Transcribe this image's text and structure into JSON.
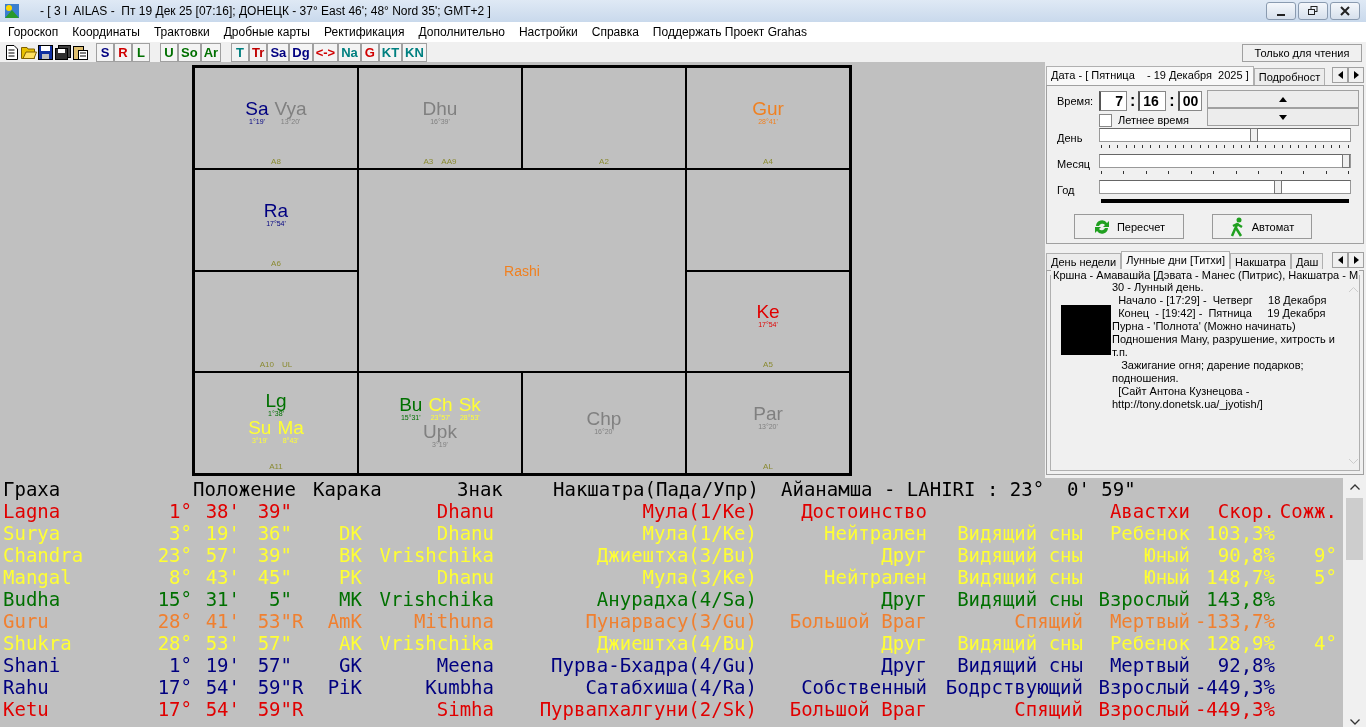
{
  "window": {
    "title": "- [ 3 I  AILAS -  Пт 19 Дек 25 [07:16]; ДОНЕЦК - 37° East 46'; 48° Nord 35'; GMT+2 ]"
  },
  "menu": [
    "Гороскоп",
    "Координаты",
    "Трактовки",
    "Дробные карты",
    "Ректификация",
    "Дополнительно",
    "Настройки",
    "Справка",
    "Поддержать Проект Grahas"
  ],
  "toolbar": {
    "groups": [
      [
        {
          "label": "S",
          "color": "#000080"
        },
        {
          "label": "R",
          "color": "#d00000"
        },
        {
          "label": "L",
          "color": "#007000"
        }
      ],
      [
        {
          "label": "U",
          "color": "#007000"
        },
        {
          "label": "So",
          "color": "#007000"
        },
        {
          "label": "Ar",
          "color": "#007000"
        }
      ],
      [
        {
          "label": "T",
          "color": "#008080"
        },
        {
          "label": "Tr",
          "color": "#c00000"
        },
        {
          "label": "Sa",
          "color": "#000080"
        },
        {
          "label": "Dg",
          "color": "#000080"
        },
        {
          "label": "<->",
          "color": "#d00000"
        },
        {
          "label": "Na",
          "color": "#008080"
        },
        {
          "label": "G",
          "color": "#d00000"
        },
        {
          "label": "KT",
          "color": "#008080"
        },
        {
          "label": "KN",
          "color": "#008080"
        }
      ]
    ],
    "read_only_button": "Только для чтения"
  },
  "chart": {
    "title": "Rashi",
    "cells": [
      {
        "lines": [
          {
            "planets": [
              {
                "abbr": "Sa",
                "deg": "1°19'",
                "color": "#000080"
              },
              {
                "abbr": "Vya",
                "deg": "13°20'",
                "color": "#808080"
              }
            ]
          }
        ],
        "labels": [
          "A8"
        ]
      },
      {
        "lines": [
          {
            "planets": [
              {
                "abbr": "Dhu",
                "deg": "16°39'",
                "color": "#808080"
              }
            ]
          }
        ],
        "labels": [
          "A3",
          "AA9"
        ]
      },
      {
        "labels": [
          "A2"
        ]
      },
      {
        "lines": [
          {
            "planets": [
              {
                "abbr": "Gur",
                "deg": "28°41'",
                "color": "#f08020"
              }
            ]
          }
        ],
        "labels": [
          "A4"
        ]
      },
      {
        "lines": [
          {
            "planets": [
              {
                "abbr": "Ra",
                "deg": "17°54'",
                "color": "#000080"
              }
            ]
          }
        ],
        "labels": [
          "A6"
        ]
      },
      {},
      {
        "labels": [
          "A10",
          "UL"
        ]
      },
      {
        "lines": [
          {
            "planets": [
              {
                "abbr": "Ke",
                "deg": "17°54'",
                "color": "#e00000"
              }
            ]
          }
        ],
        "labels": [
          "A5"
        ]
      },
      {
        "lines": [
          {
            "planets": [
              {
                "abbr": "Lg",
                "deg": "1°38'",
                "color": "#007000"
              }
            ]
          },
          {
            "planets": [
              {
                "abbr": "Su",
                "deg": "3°19'",
                "color": "#ffff33"
              },
              {
                "abbr": "Ma",
                "deg": "8°43'",
                "color": "#ffff33"
              }
            ]
          }
        ],
        "labels": [
          "A11"
        ]
      },
      {
        "lines": [
          {
            "planets": [
              {
                "abbr": "Bu",
                "deg": "15°31'",
                "color": "#007000"
              },
              {
                "abbr": "Ch",
                "deg": "23°57'",
                "color": "#ffff33"
              },
              {
                "abbr": "Sk",
                "deg": "28°53'",
                "color": "#ffff33"
              }
            ]
          },
          {
            "planets": [
              {
                "abbr": "Upk",
                "deg": "3°19'",
                "color": "#808080"
              }
            ]
          }
        ]
      },
      {
        "lines": [
          {
            "planets": [
              {
                "abbr": "Chp",
                "deg": "16°20'",
                "color": "#808080"
              }
            ]
          }
        ]
      },
      {
        "lines": [
          {
            "planets": [
              {
                "abbr": "Par",
                "deg": "13°20'",
                "color": "#808080"
              }
            ]
          }
        ],
        "labels": [
          "AL"
        ]
      }
    ]
  },
  "date_panel": {
    "tabs": [
      {
        "label": "Дата - [ Пятница    - 19 Декабря  2025 ]",
        "selected": true
      },
      {
        "label": "Подробност",
        "selected": false
      }
    ],
    "time_label": "Время:",
    "hour": "7",
    "minute": "16",
    "second": "00",
    "separators": [
      ":",
      ":"
    ],
    "dst": {
      "label": "Летнее время",
      "checked": false
    },
    "sliders": [
      {
        "label": "День",
        "kind": "day",
        "level": 0.62
      },
      {
        "label": "Месяц",
        "kind": "month",
        "level": 1.0
      },
      {
        "label": "Год",
        "kind": "year",
        "level": 0.72
      }
    ],
    "buttons": [
      {
        "label": "Пересчет",
        "kind": "refresh"
      },
      {
        "label": "Автомат",
        "kind": "auto"
      }
    ]
  },
  "info_panel": {
    "tabs": [
      {
        "label": "День недели",
        "selected": false
      },
      {
        "label": "Лунные дни [Титхи]",
        "selected": true
      },
      {
        "label": "Накшатра",
        "selected": false
      },
      {
        "label": "Даш",
        "selected": false
      }
    ],
    "group_title": "Кршна - Амавашйа [Дэвата - Манес (Питрис), Накшатра - М",
    "lines": [
      "30 - Лунный день.",
      "  Начало - [17:29] -  Четверг     18 Декабря",
      "  Конец  - [19:42] -  Пятница     19 Декабря",
      "Пурна - 'Полнота' (Можно начинать)",
      "Подношения Ману, разрушение, хитрость и т.п.",
      "   Зажигание огня; дарение подарков; подношения.",
      "  [Сайт Антона Кузнецова - http://tony.donetsk.ua/_jyotish/]"
    ]
  },
  "table": {
    "header": [
      "Граха",
      "Положение",
      "Карака",
      "Знак",
      "Накшатра(Пада/Упр)",
      "Айанамша - LAHIRI : 23°  0' 59\""
    ],
    "rows": [
      {
        "name": "Lagna",
        "deg": "1°",
        "min": "38'",
        "sec": "39\"",
        "sign": "Dhanu",
        "nakshatra": "Мула(1/Ke)",
        "dignity": "Достоинство",
        "age": "Авастхи",
        "speed": "Скор.",
        "combust": "Сожж.",
        "color": "#e00000"
      },
      {
        "name": "Surya",
        "deg": "3°",
        "min": "19'",
        "sec": "36\"",
        "karaka": "DK",
        "sign": "Dhanu",
        "nakshatra": "Мула(1/Ke)",
        "dignity": "Нейтрален",
        "avastha": "Видящий сны",
        "age": "Ребенок",
        "speed": "103,3%",
        "color": "#ffff33"
      },
      {
        "name": "Chandra",
        "deg": "23°",
        "min": "57'",
        "sec": "39\"",
        "karaka": "BK",
        "sign": "Vrishchika",
        "nakshatra": "Джиештха(3/Bu)",
        "dignity": "Друг",
        "avastha": "Видящий сны",
        "age": "Юный",
        "speed": "90,8%",
        "combust": "9°",
        "color": "#ffff33"
      },
      {
        "name": "Mangal",
        "deg": "8°",
        "min": "43'",
        "sec": "45\"",
        "karaka": "PK",
        "sign": "Dhanu",
        "nakshatra": "Мула(3/Ke)",
        "dignity": "Нейтрален",
        "avastha": "Видящий сны",
        "age": "Юный",
        "speed": "148,7%",
        "combust": "5°",
        "color": "#ffff33"
      },
      {
        "name": "Budha",
        "deg": "15°",
        "min": "31'",
        "sec": "5\"",
        "karaka": "MK",
        "sign": "Vrishchika",
        "nakshatra": "Анурадха(4/Sa)",
        "dignity": "Друг",
        "avastha": "Видящий сны",
        "age": "Взрослый",
        "speed": "143,8%",
        "color": "#007000"
      },
      {
        "name": "Guru",
        "deg": "28°",
        "min": "41'",
        "sec": "53\"",
        "flag": "R",
        "karaka": "AmK",
        "sign": "Mithuna",
        "nakshatra": "Пунарвасу(3/Gu)",
        "dignity": "Большой Враг",
        "avastha": "Спящий",
        "age": "Мертвый",
        "speed": "-133,7%",
        "color": "#f08030"
      },
      {
        "name": "Shukra",
        "deg": "28°",
        "min": "53'",
        "sec": "57\"",
        "karaka": "AK",
        "sign": "Vrishchika",
        "nakshatra": "Джиештха(4/Bu)",
        "dignity": "Друг",
        "avastha": "Видящий сны",
        "age": "Ребенок",
        "speed": "128,9%",
        "combust": "4°",
        "color": "#ffff33"
      },
      {
        "name": "Shani",
        "deg": "1°",
        "min": "19'",
        "sec": "57\"",
        "karaka": "GK",
        "sign": "Meena",
        "nakshatra": "Пурва-Бхадра(4/Gu)",
        "dignity": "Друг",
        "avastha": "Видящий сны",
        "age": "Мертвый",
        "speed": "92,8%",
        "color": "#000080"
      },
      {
        "name": "Rahu",
        "deg": "17°",
        "min": "54'",
        "sec": "59\"",
        "flag": "R",
        "karaka": "PiK",
        "sign": "Kumbha",
        "nakshatra": "Сатабхиша(4/Ra)",
        "dignity": "Собственный",
        "avastha": "Бодрствующий",
        "age": "Взрослый",
        "speed": "-449,3%",
        "color": "#000080"
      },
      {
        "name": "Ketu",
        "deg": "17°",
        "min": "54'",
        "sec": "59\"",
        "flag": "R",
        "sign": "Simha",
        "nakshatra": "Пурвапхалгуни(2/Sk)",
        "dignity": "Большой Враг",
        "avastha": "Спящий",
        "age": "Взрослый",
        "speed": "-449,3%",
        "color": "#e00000"
      }
    ]
  }
}
